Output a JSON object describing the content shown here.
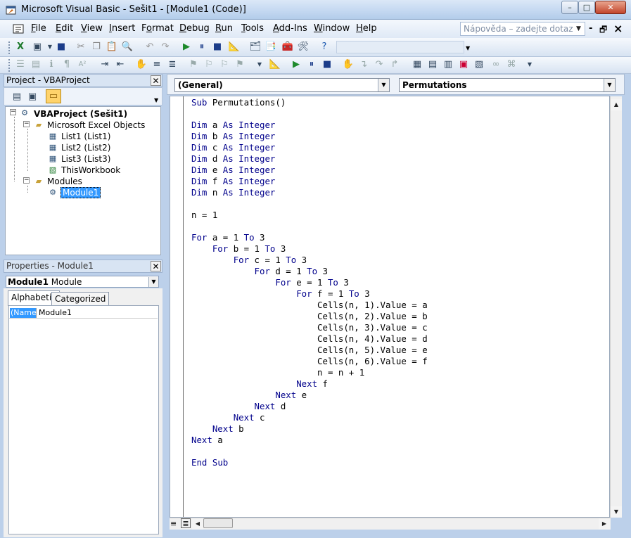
{
  "window": {
    "title": "Microsoft Visual Basic - Sešit1 - [Module1 (Code)]",
    "min_glyph": "–",
    "max_glyph": "□",
    "close_glyph": "✕"
  },
  "menu": {
    "items": [
      {
        "label": "File"
      },
      {
        "label": "Edit"
      },
      {
        "label": "View"
      },
      {
        "label": "Insert"
      },
      {
        "label": "Format"
      },
      {
        "label": "Debug"
      },
      {
        "label": "Run"
      },
      {
        "label": "Tools"
      },
      {
        "label": "Add-Ins"
      },
      {
        "label": "Window"
      },
      {
        "label": "Help"
      }
    ],
    "help_placeholder": "Nápověda – zadejte dotaz",
    "doc_min": "-",
    "doc_restore": "🗗",
    "doc_close": "×"
  },
  "project": {
    "title": "Project - VBAProject",
    "tree": [
      {
        "label": "VBAProject (Sešit1)",
        "icon": "vba-project-icon"
      },
      {
        "label": "Microsoft Excel Objects",
        "icon": "folder-icon"
      },
      {
        "label": "List1 (List1)",
        "icon": "worksheet-icon"
      },
      {
        "label": "List2 (List2)",
        "icon": "worksheet-icon"
      },
      {
        "label": "List3 (List3)",
        "icon": "worksheet-icon"
      },
      {
        "label": "ThisWorkbook",
        "icon": "workbook-icon"
      },
      {
        "label": "Modules",
        "icon": "folder-icon"
      },
      {
        "label": "Module1",
        "icon": "module-icon",
        "selected": true
      }
    ]
  },
  "properties": {
    "title": "Properties - Module1",
    "object_name": "Module1",
    "object_type": "Module",
    "tabs": [
      "Alphabetic",
      "Categorized"
    ],
    "rows": [
      {
        "name": "(Name)",
        "value": "Module1"
      }
    ]
  },
  "code": {
    "object_combo": "(General)",
    "proc_combo": "Permutations",
    "lines": [
      "Sub Permutations()",
      "",
      "Dim a As Integer",
      "Dim b As Integer",
      "Dim c As Integer",
      "Dim d As Integer",
      "Dim e As Integer",
      "Dim f As Integer",
      "Dim n As Integer",
      "",
      "n = 1",
      "",
      "For a = 1 To 3",
      "    For b = 1 To 3",
      "        For c = 1 To 3",
      "            For d = 1 To 3",
      "                For e = 1 To 3",
      "                    For f = 1 To 3",
      "                        Cells(n, 1).Value = a",
      "                        Cells(n, 2).Value = b",
      "                        Cells(n, 3).Value = c",
      "                        Cells(n, 4).Value = d",
      "                        Cells(n, 5).Value = e",
      "                        Cells(n, 6).Value = f",
      "                        n = n + 1",
      "                    Next f",
      "                Next e",
      "            Next d",
      "        Next c",
      "    Next b",
      "Next a",
      "",
      "End Sub"
    ]
  },
  "colors": {
    "keyword": "#00008b",
    "selection": "#3399ff"
  }
}
